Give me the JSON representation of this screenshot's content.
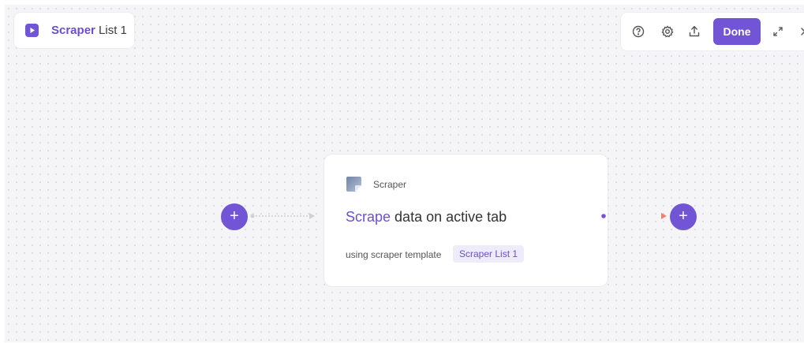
{
  "header": {
    "title_accent": "Scraper",
    "title_rest": " List 1",
    "play_icon": "play-icon"
  },
  "toolbar": {
    "help_icon": "help-circle-icon",
    "settings_icon": "gear-icon",
    "export_icon": "upload-icon",
    "done_label": "Done",
    "expand_icon": "expand-icon",
    "close_icon": "close-icon"
  },
  "node": {
    "type_label": "Scraper",
    "title_accent": "Scrape",
    "title_rest": " data on active tab",
    "subtitle": "using scraper template",
    "template_name": "Scraper List 1"
  },
  "add_buttons": {
    "label": "+"
  },
  "colors": {
    "accent": "#7155d4",
    "edge_start": "#7155d4",
    "edge_end": "#f0806a"
  }
}
